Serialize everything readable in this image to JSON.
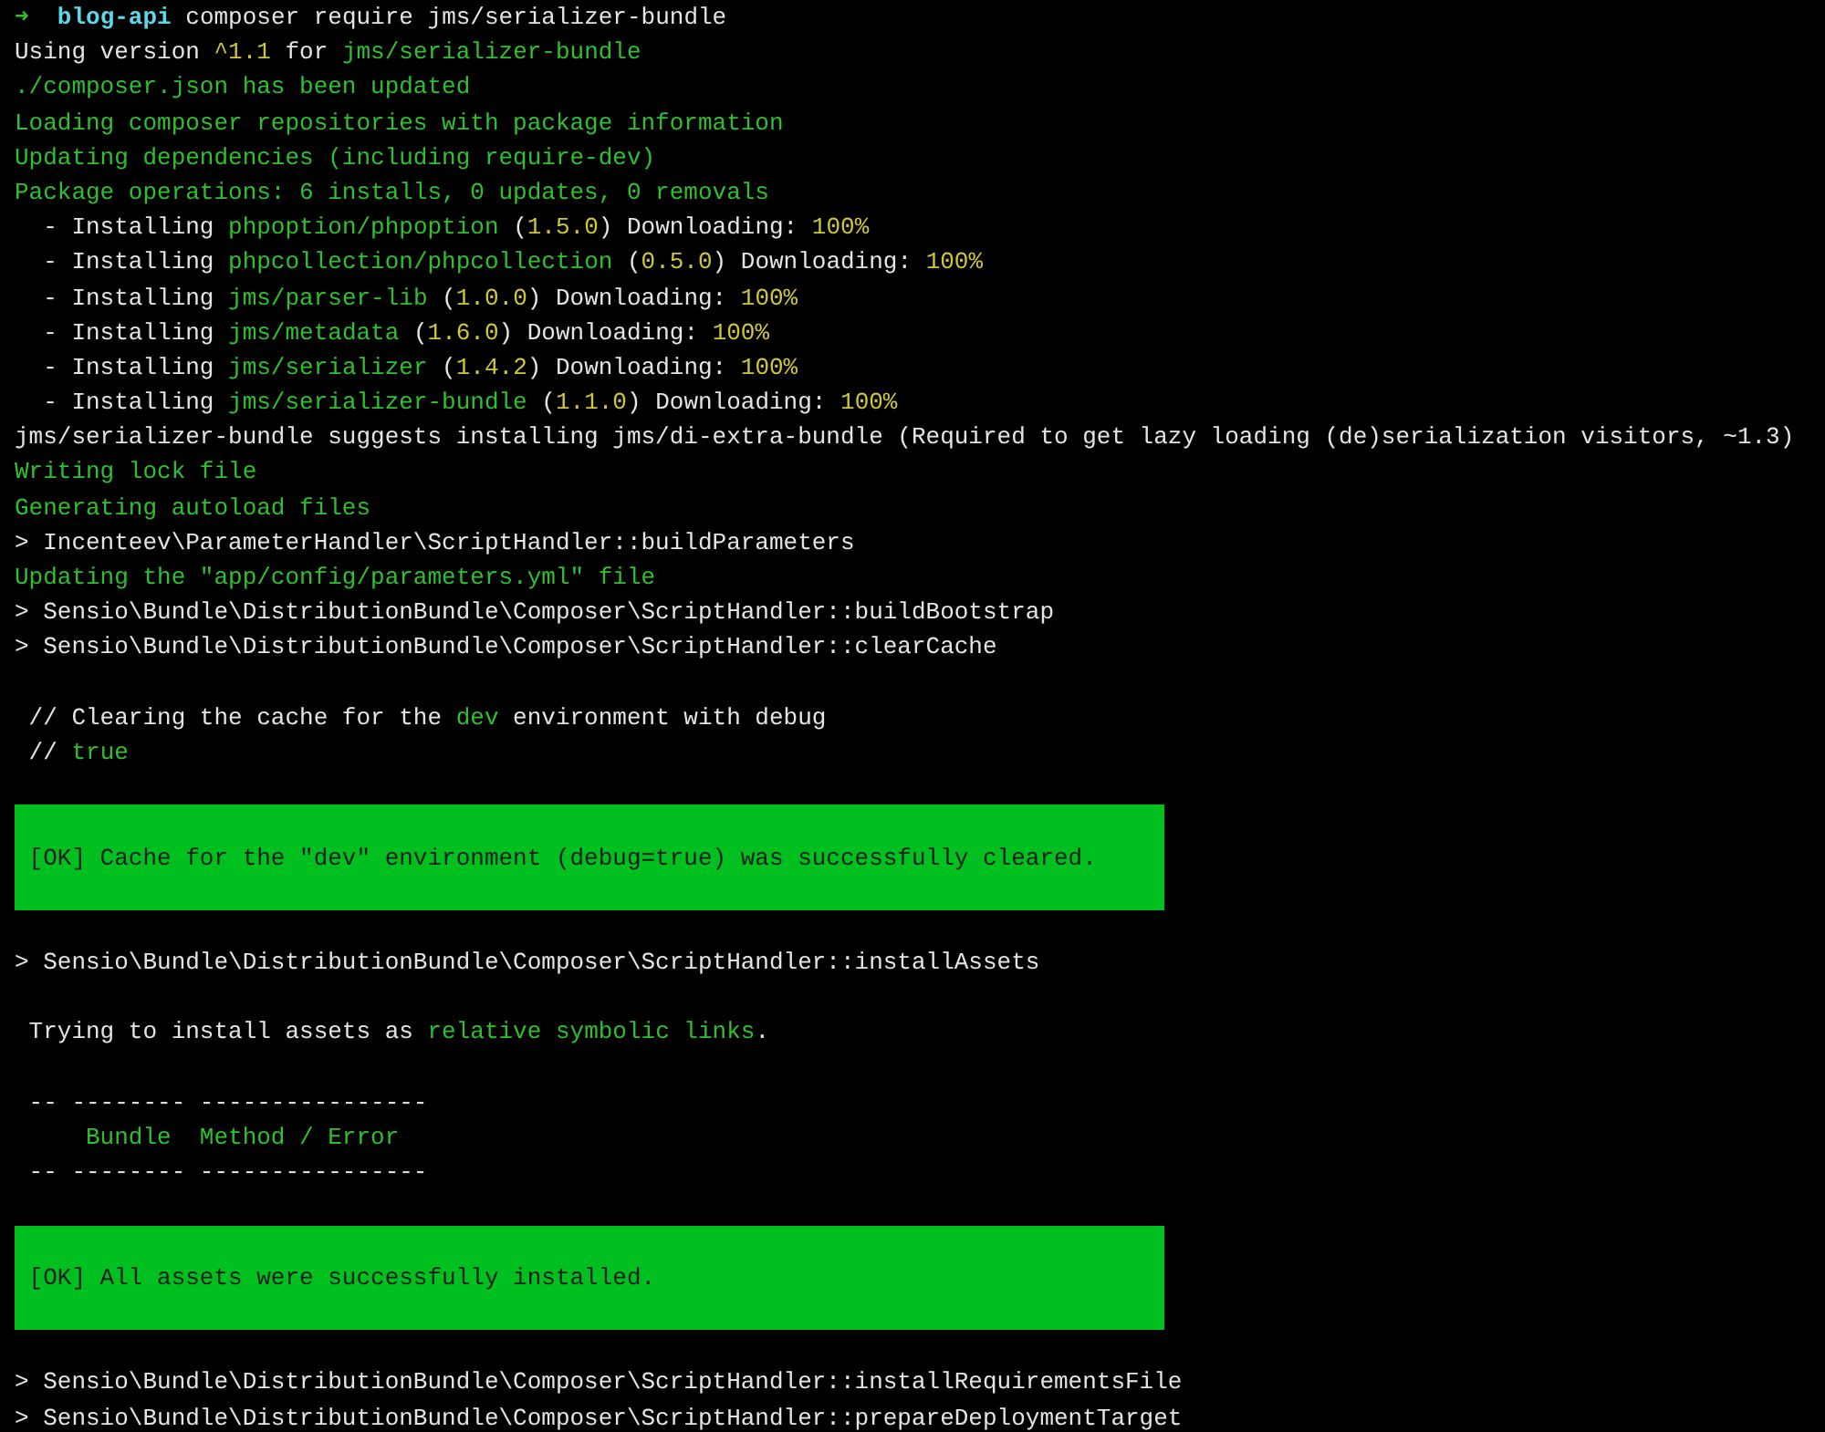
{
  "terminal": {
    "lines": [
      {
        "kind": "text",
        "segments": [
          {
            "kind": "arrow",
            "text": "➜"
          },
          {
            "kind": "directory",
            "text": "  blog-api"
          },
          {
            "kind": "plain",
            "text": " composer require jms/serializer-bundle"
          }
        ]
      },
      {
        "kind": "text",
        "segments": [
          {
            "kind": "plain",
            "text": "Using version "
          },
          {
            "kind": "number",
            "text": "^1.1"
          },
          {
            "kind": "plain",
            "text": " for "
          },
          {
            "kind": "info",
            "text": "jms/serializer-bundle"
          }
        ]
      },
      {
        "kind": "text",
        "segments": [
          {
            "kind": "info",
            "text": "./composer.json has been updated"
          }
        ]
      },
      {
        "kind": "text",
        "segments": [
          {
            "kind": "info",
            "text": "Loading composer repositories with package information"
          }
        ]
      },
      {
        "kind": "text",
        "segments": [
          {
            "kind": "info",
            "text": "Updating dependencies (including require-dev)"
          }
        ]
      },
      {
        "kind": "text",
        "segments": [
          {
            "kind": "info",
            "text": "Package operations: 6 installs, 0 updates, 0 removals"
          }
        ]
      },
      {
        "kind": "text",
        "segments": [
          {
            "kind": "plain",
            "text": "  - Installing "
          },
          {
            "kind": "info",
            "text": "phpoption/phpoption"
          },
          {
            "kind": "plain",
            "text": " ("
          },
          {
            "kind": "number",
            "text": "1.5.0"
          },
          {
            "kind": "plain",
            "text": ") Downloading: "
          },
          {
            "kind": "number",
            "text": "100%"
          }
        ]
      },
      {
        "kind": "text",
        "segments": [
          {
            "kind": "plain",
            "text": "  - Installing "
          },
          {
            "kind": "info",
            "text": "phpcollection/phpcollection"
          },
          {
            "kind": "plain",
            "text": " ("
          },
          {
            "kind": "number",
            "text": "0.5.0"
          },
          {
            "kind": "plain",
            "text": ") Downloading: "
          },
          {
            "kind": "number",
            "text": "100%"
          }
        ]
      },
      {
        "kind": "text",
        "segments": [
          {
            "kind": "plain",
            "text": "  - Installing "
          },
          {
            "kind": "info",
            "text": "jms/parser-lib"
          },
          {
            "kind": "plain",
            "text": " ("
          },
          {
            "kind": "number",
            "text": "1.0.0"
          },
          {
            "kind": "plain",
            "text": ") Downloading: "
          },
          {
            "kind": "number",
            "text": "100%"
          }
        ]
      },
      {
        "kind": "text",
        "segments": [
          {
            "kind": "plain",
            "text": "  - Installing "
          },
          {
            "kind": "info",
            "text": "jms/metadata"
          },
          {
            "kind": "plain",
            "text": " ("
          },
          {
            "kind": "number",
            "text": "1.6.0"
          },
          {
            "kind": "plain",
            "text": ") Downloading: "
          },
          {
            "kind": "number",
            "text": "100%"
          }
        ]
      },
      {
        "kind": "text",
        "segments": [
          {
            "kind": "plain",
            "text": "  - Installing "
          },
          {
            "kind": "info",
            "text": "jms/serializer"
          },
          {
            "kind": "plain",
            "text": " ("
          },
          {
            "kind": "number",
            "text": "1.4.2"
          },
          {
            "kind": "plain",
            "text": ") Downloading: "
          },
          {
            "kind": "number",
            "text": "100%"
          }
        ]
      },
      {
        "kind": "text",
        "segments": [
          {
            "kind": "plain",
            "text": "  - Installing "
          },
          {
            "kind": "info",
            "text": "jms/serializer-bundle"
          },
          {
            "kind": "plain",
            "text": " ("
          },
          {
            "kind": "number",
            "text": "1.1.0"
          },
          {
            "kind": "plain",
            "text": ") Downloading: "
          },
          {
            "kind": "number",
            "text": "100%"
          }
        ]
      },
      {
        "kind": "text",
        "segments": [
          {
            "kind": "plain",
            "text": "jms/serializer-bundle suggests installing jms/di-extra-bundle (Required to get lazy loading (de)serialization visitors, ~1.3)"
          }
        ]
      },
      {
        "kind": "text",
        "segments": [
          {
            "kind": "info",
            "text": "Writing lock file"
          }
        ]
      },
      {
        "kind": "text",
        "segments": [
          {
            "kind": "info",
            "text": "Generating autoload files"
          }
        ]
      },
      {
        "kind": "text",
        "segments": [
          {
            "kind": "plain",
            "text": "> Incenteev\\ParameterHandler\\ScriptHandler::buildParameters"
          }
        ]
      },
      {
        "kind": "text",
        "segments": [
          {
            "kind": "info",
            "text": "Updating the \"app/config/parameters.yml\" file"
          }
        ]
      },
      {
        "kind": "text",
        "segments": [
          {
            "kind": "plain",
            "text": "> Sensio\\Bundle\\DistributionBundle\\Composer\\ScriptHandler::buildBootstrap"
          }
        ]
      },
      {
        "kind": "text",
        "segments": [
          {
            "kind": "plain",
            "text": "> Sensio\\Bundle\\DistributionBundle\\Composer\\ScriptHandler::clearCache"
          }
        ]
      },
      {
        "kind": "blank"
      },
      {
        "kind": "text",
        "segments": [
          {
            "kind": "plain",
            "text": " // Clearing the cache for the "
          },
          {
            "kind": "info",
            "text": "dev"
          },
          {
            "kind": "plain",
            "text": " environment with debug"
          }
        ]
      },
      {
        "kind": "text",
        "segments": [
          {
            "kind": "plain",
            "text": " // "
          },
          {
            "kind": "info",
            "text": "true"
          }
        ]
      },
      {
        "kind": "blank"
      },
      {
        "kind": "banner",
        "segments": [
          {
            "kind": "plain",
            "text": " [OK] Cache for the \"dev\" environment (debug=true) was successfully cleared."
          }
        ]
      },
      {
        "kind": "blank"
      },
      {
        "kind": "text",
        "segments": [
          {
            "kind": "plain",
            "text": "> Sensio\\Bundle\\DistributionBundle\\Composer\\ScriptHandler::installAssets"
          }
        ]
      },
      {
        "kind": "blank"
      },
      {
        "kind": "text",
        "segments": [
          {
            "kind": "plain",
            "text": " Trying to install assets as "
          },
          {
            "kind": "info",
            "text": "relative symbolic links"
          },
          {
            "kind": "plain",
            "text": "."
          }
        ]
      },
      {
        "kind": "blank"
      },
      {
        "kind": "text",
        "segments": [
          {
            "kind": "plain",
            "text": " -- -------- ----------------"
          }
        ]
      },
      {
        "kind": "text",
        "segments": [
          {
            "kind": "info",
            "text": "     Bundle  Method / Error"
          }
        ]
      },
      {
        "kind": "text",
        "segments": [
          {
            "kind": "plain",
            "text": " -- -------- ----------------"
          }
        ]
      },
      {
        "kind": "blank"
      },
      {
        "kind": "banner",
        "segments": [
          {
            "kind": "plain",
            "text": " [OK] All assets were successfully installed."
          }
        ]
      },
      {
        "kind": "blank"
      },
      {
        "kind": "text",
        "segments": [
          {
            "kind": "plain",
            "text": "> Sensio\\Bundle\\DistributionBundle\\Composer\\ScriptHandler::installRequirementsFile"
          }
        ]
      },
      {
        "kind": "text",
        "segments": [
          {
            "kind": "plain",
            "text": "> Sensio\\Bundle\\DistributionBundle\\Composer\\ScriptHandler::prepareDeploymentTarget"
          }
        ]
      }
    ]
  }
}
